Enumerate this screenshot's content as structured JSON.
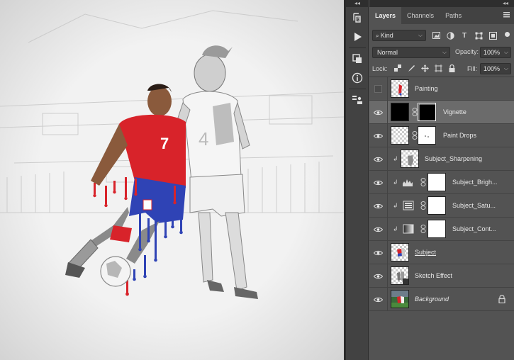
{
  "tools_panel": {
    "collapse_label": "◂◂",
    "tools": [
      "history-icon",
      "play-action-icon",
      "3d-icon",
      "info-icon",
      "clone-source-icon"
    ]
  },
  "panel": {
    "collapse_label": "◂◂",
    "tabs": [
      {
        "label": "Layers",
        "active": true
      },
      {
        "label": "Channels",
        "active": false
      },
      {
        "label": "Paths",
        "active": false
      }
    ],
    "filter": {
      "kind_label": "Kind"
    },
    "blend_mode": "Normal",
    "opacity_label": "Opacity:",
    "opacity_value": "100%",
    "lock_label": "Lock:",
    "fill_label": "Fill:",
    "fill_value": "100%"
  },
  "layers": [
    {
      "name": "Painting",
      "visible": false,
      "thumb": "checker-paint",
      "mask": null,
      "clipped": false,
      "selected": false,
      "italic": false,
      "underline": false,
      "locked": false
    },
    {
      "name": "Vignette",
      "visible": true,
      "thumb": "black",
      "mask": "black-vignette",
      "clipped": false,
      "selected": true,
      "italic": false,
      "underline": false,
      "locked": false
    },
    {
      "name": "Paint Drops",
      "visible": true,
      "thumb": "checker",
      "mask": "white-dots",
      "clipped": false,
      "selected": false,
      "italic": false,
      "underline": false,
      "locked": false
    },
    {
      "name": "Subject_Sharpening",
      "visible": true,
      "thumb": "checker-subject",
      "mask": null,
      "clipped": true,
      "selected": false,
      "italic": false,
      "underline": false,
      "locked": false
    },
    {
      "name": "Subject_Brigh...",
      "visible": true,
      "thumb": "brightness-icon",
      "mask": "white",
      "clipped": true,
      "selected": false,
      "italic": false,
      "underline": false,
      "locked": false
    },
    {
      "name": "Subject_Satu...",
      "visible": true,
      "thumb": "saturation-icon",
      "mask": "white",
      "clipped": true,
      "selected": false,
      "italic": false,
      "underline": false,
      "locked": false
    },
    {
      "name": "Subject_Cont...",
      "visible": true,
      "thumb": "contrast-icon",
      "mask": "white",
      "clipped": true,
      "selected": false,
      "italic": false,
      "underline": false,
      "locked": false
    },
    {
      "name": "Subject",
      "visible": true,
      "thumb": "checker-subject",
      "mask": null,
      "clipped": false,
      "selected": false,
      "italic": false,
      "underline": true,
      "locked": false
    },
    {
      "name": "Sketch Effect",
      "visible": true,
      "thumb": "checker-sketch",
      "mask": null,
      "clipped": false,
      "selected": false,
      "italic": false,
      "underline": false,
      "locked": false
    },
    {
      "name": "Background",
      "visible": true,
      "thumb": "photo",
      "mask": null,
      "clipped": false,
      "selected": false,
      "italic": true,
      "underline": false,
      "locked": true
    }
  ],
  "colors": {
    "panel_bg": "#535353",
    "panel_dark": "#424242",
    "selected_row": "#6b6b6b",
    "jersey_red": "#d8232a",
    "shorts_blue": "#2f43b5"
  }
}
